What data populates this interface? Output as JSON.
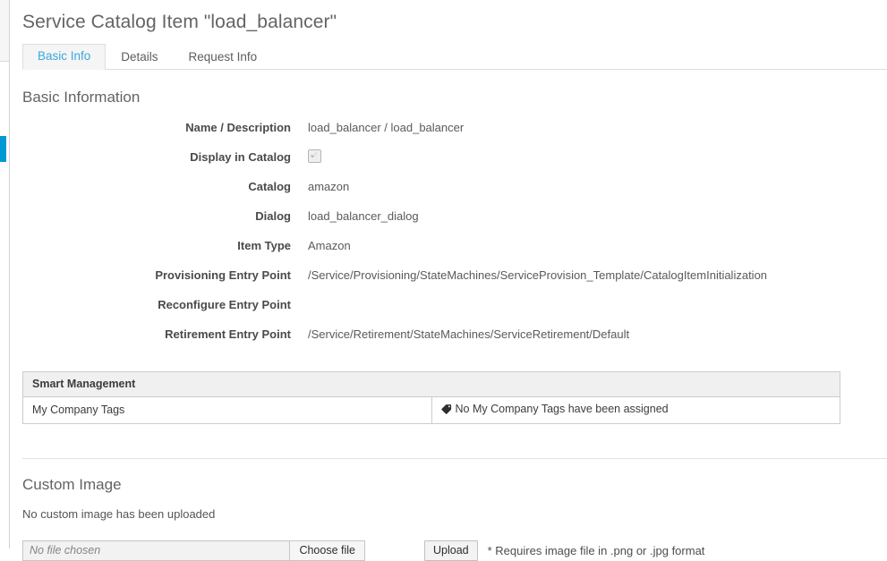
{
  "left_rail": {
    "active_indicator_color": "#0099d3"
  },
  "header": {
    "title": "Service Catalog Item \"load_balancer\""
  },
  "tabs": [
    {
      "label": "Basic Info",
      "active": true
    },
    {
      "label": "Details",
      "active": false
    },
    {
      "label": "Request Info",
      "active": false
    }
  ],
  "basic_information": {
    "heading": "Basic Information",
    "fields": [
      {
        "label": "Name / Description",
        "value": "load_balancer / load_balancer",
        "type": "text"
      },
      {
        "label": "Display in Catalog",
        "value": "",
        "type": "checkbox",
        "checked": true,
        "disabled": true
      },
      {
        "label": "Catalog",
        "value": "amazon",
        "type": "text"
      },
      {
        "label": "Dialog",
        "value": "load_balancer_dialog",
        "type": "text"
      },
      {
        "label": "Item Type",
        "value": "Amazon",
        "type": "text"
      },
      {
        "label": "Provisioning Entry Point",
        "value": "/Service/Provisioning/StateMachines/ServiceProvision_Template/CatalogItemInitialization",
        "type": "text"
      },
      {
        "label": "Reconfigure Entry Point",
        "value": "",
        "type": "text"
      },
      {
        "label": "Retirement Entry Point",
        "value": "/Service/Retirement/StateMachines/ServiceRetirement/Default",
        "type": "text"
      }
    ]
  },
  "smart_management": {
    "header": "Smart Management",
    "rows": [
      {
        "label": "My Company Tags",
        "icon": "tag-icon",
        "value": "No My Company Tags have been assigned"
      }
    ]
  },
  "custom_image": {
    "heading": "Custom Image",
    "status": "No custom image has been uploaded",
    "file_input": {
      "placeholder": "No file chosen",
      "value": "No file chosen",
      "browse_label": "Choose file"
    },
    "upload_label": "Upload",
    "note": "* Requires image file in .png or .jpg format"
  },
  "colors": {
    "accent_blue": "#3aa8dd",
    "rail_blue": "#0099d3",
    "title_gray": "#646464",
    "table_header_bg": "#f0f0f0",
    "border_gray": "#cccccc"
  }
}
